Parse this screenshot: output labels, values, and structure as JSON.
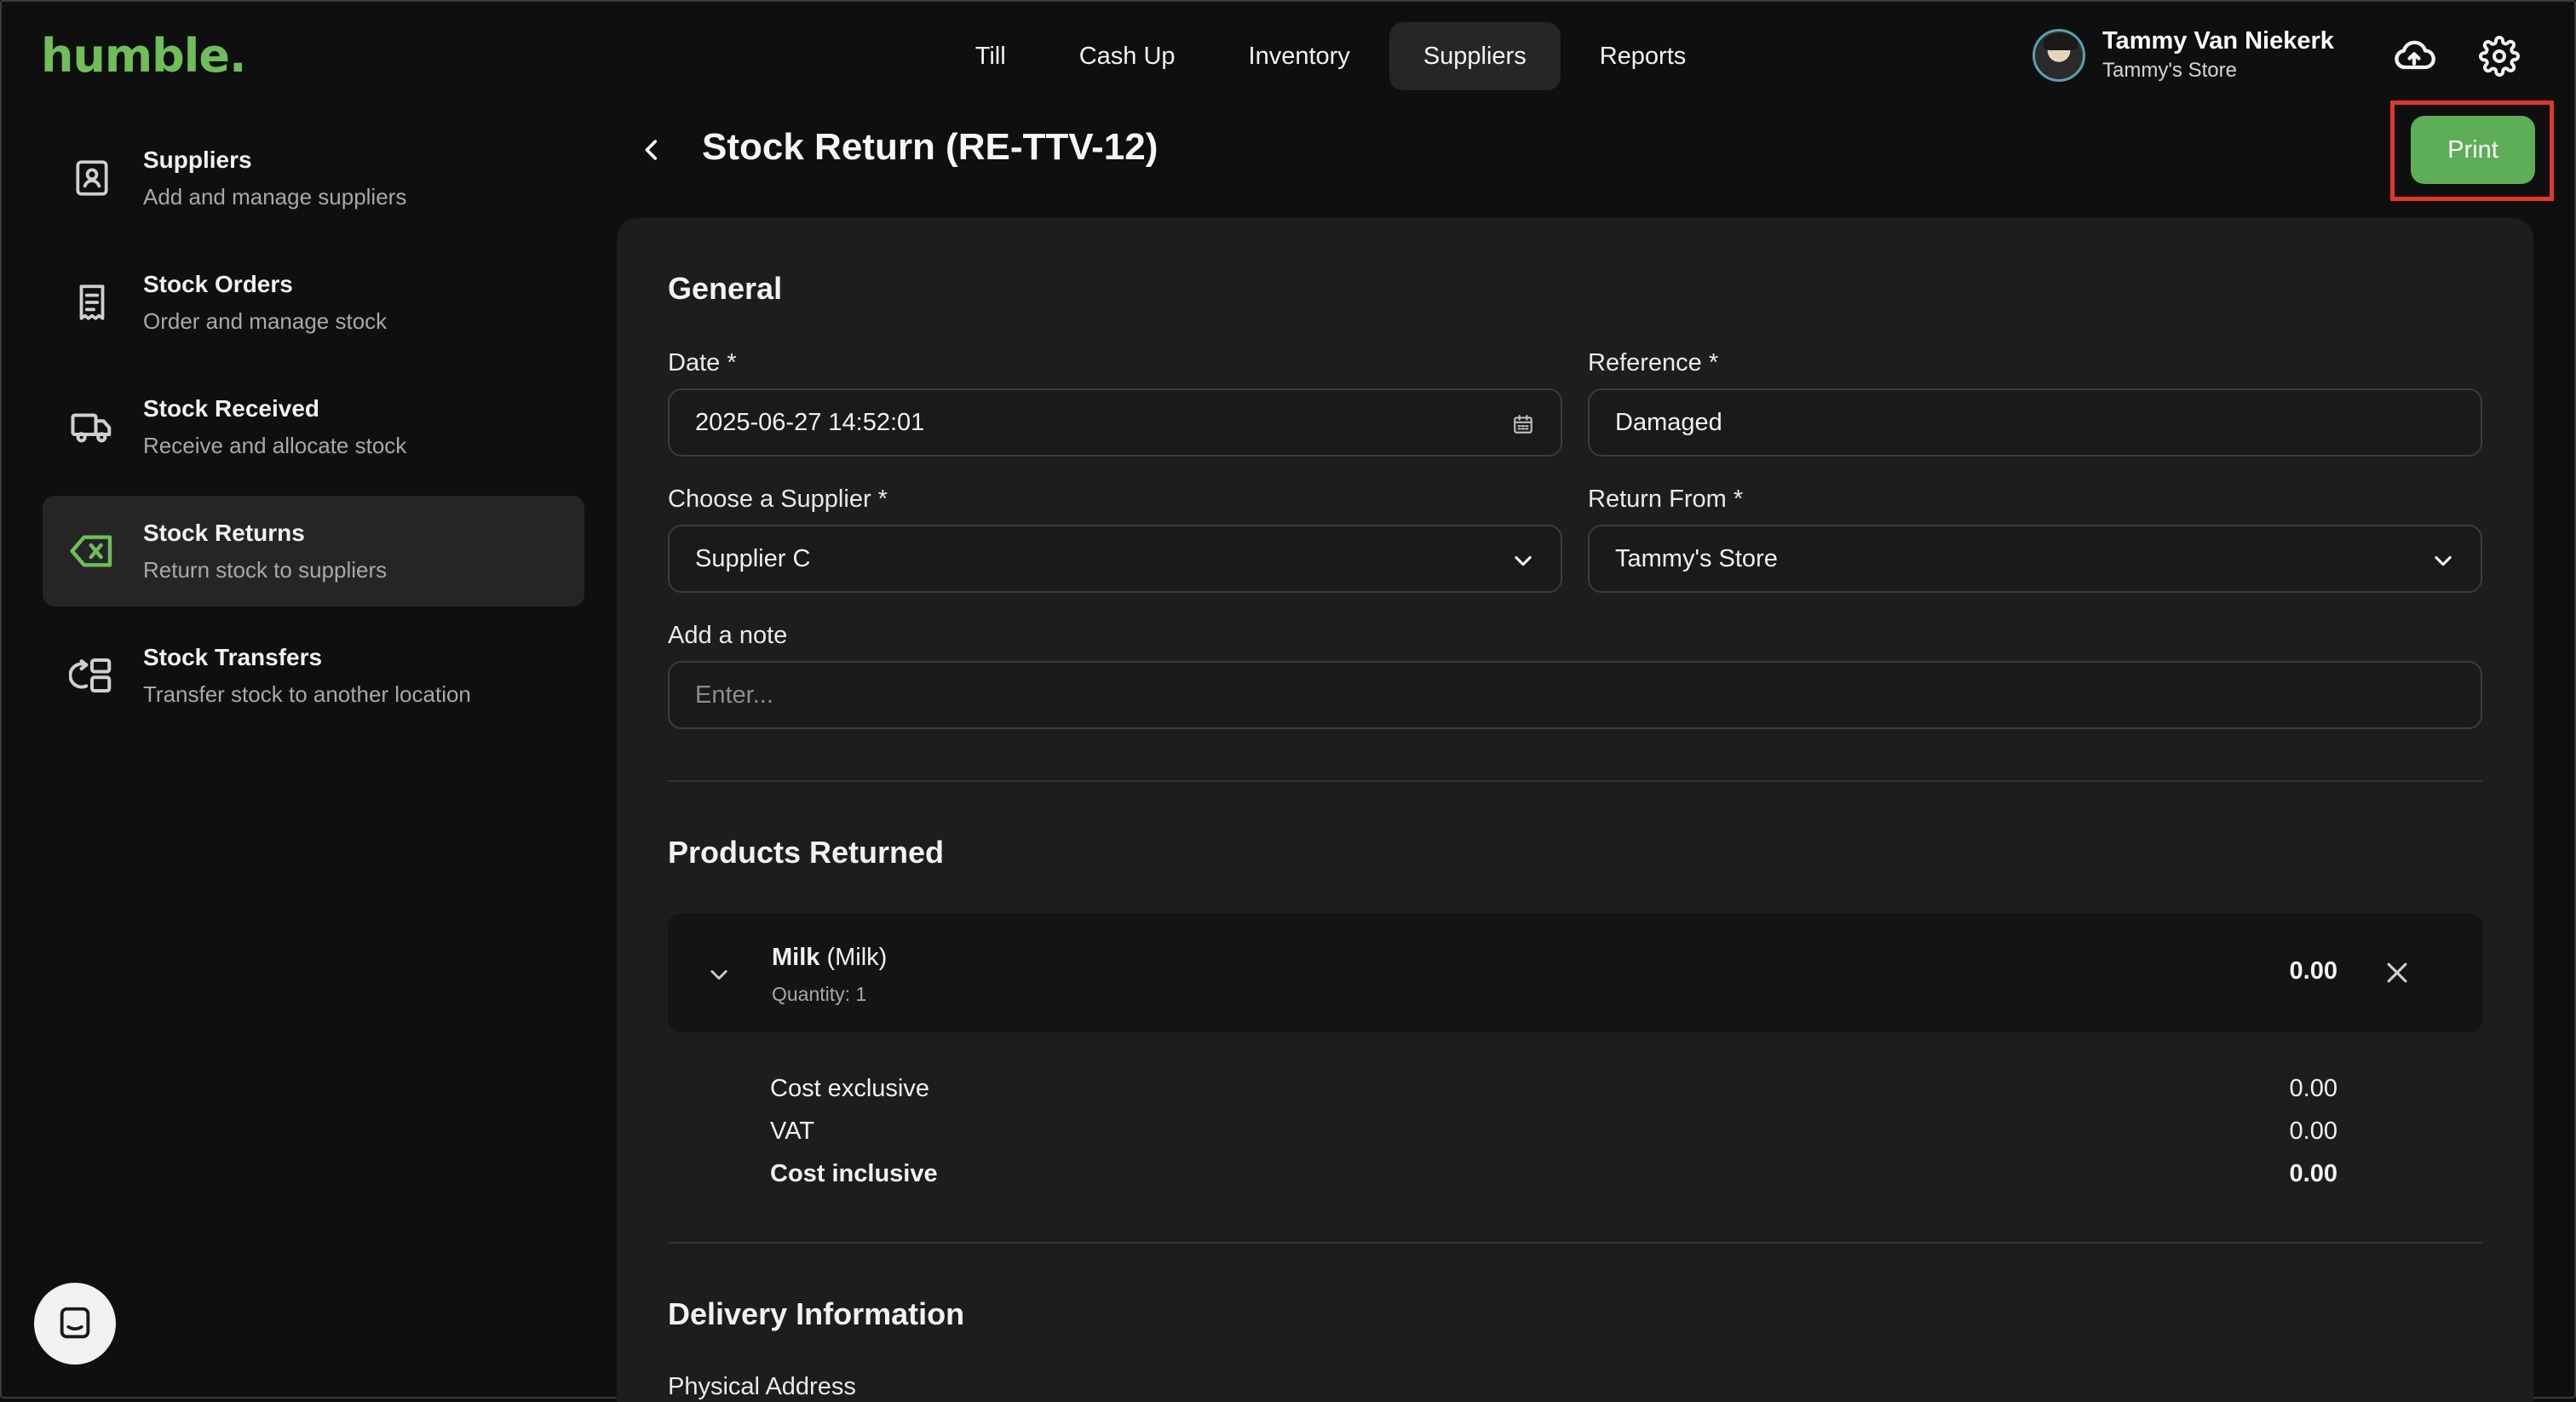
{
  "app": {
    "logo": "humble."
  },
  "nav": {
    "items": [
      {
        "label": "Till",
        "active": false
      },
      {
        "label": "Cash Up",
        "active": false
      },
      {
        "label": "Inventory",
        "active": false
      },
      {
        "label": "Suppliers",
        "active": true
      },
      {
        "label": "Reports",
        "active": false
      }
    ]
  },
  "user": {
    "name": "Tammy Van Niekerk",
    "store": "Tammy's Store"
  },
  "icons": {
    "upload": "cloud-upload-icon",
    "settings": "gear-icon",
    "back": "chevron-left-icon",
    "chat": "chat-icon"
  },
  "sidebar": {
    "items": [
      {
        "title": "Suppliers",
        "subtitle": "Add and manage suppliers",
        "icon": "supplier-badge-icon",
        "active": false
      },
      {
        "title": "Stock Orders",
        "subtitle": "Order and manage stock",
        "icon": "receipt-icon",
        "active": false
      },
      {
        "title": "Stock Received",
        "subtitle": "Receive and allocate stock",
        "icon": "truck-icon",
        "active": false
      },
      {
        "title": "Stock Returns",
        "subtitle": "Return stock to suppliers",
        "icon": "return-x-icon",
        "active": true
      },
      {
        "title": "Stock Transfers",
        "subtitle": "Transfer stock to another location",
        "icon": "transfer-icon",
        "active": false
      }
    ]
  },
  "page": {
    "title": "Stock Return (RE-TTV-12)",
    "print_label": "Print"
  },
  "general": {
    "title": "General",
    "date_label": "Date *",
    "date_value": "2025-06-27 14:52:01",
    "reference_label": "Reference *",
    "reference_value": "Damaged",
    "supplier_label": "Choose a Supplier *",
    "supplier_value": "Supplier C",
    "return_from_label": "Return From *",
    "return_from_value": "Tammy's Store",
    "note_label": "Add a note",
    "note_placeholder": "Enter..."
  },
  "products": {
    "title": "Products Returned",
    "items": [
      {
        "name": "Milk",
        "variant": "(Milk)",
        "quantity": "Quantity: 1",
        "total": "0.00",
        "cost_exclusive_label": "Cost exclusive",
        "cost_exclusive": "0.00",
        "vat_label": "VAT",
        "vat": "0.00",
        "cost_inclusive_label": "Cost inclusive",
        "cost_inclusive": "0.00"
      }
    ]
  },
  "delivery": {
    "title": "Delivery Information",
    "address_label": "Physical Address"
  },
  "colors": {
    "accent": "#5dae57",
    "logo": "#6fbe5a",
    "highlight": "#e2372b",
    "panel": "#1d1d1d"
  }
}
